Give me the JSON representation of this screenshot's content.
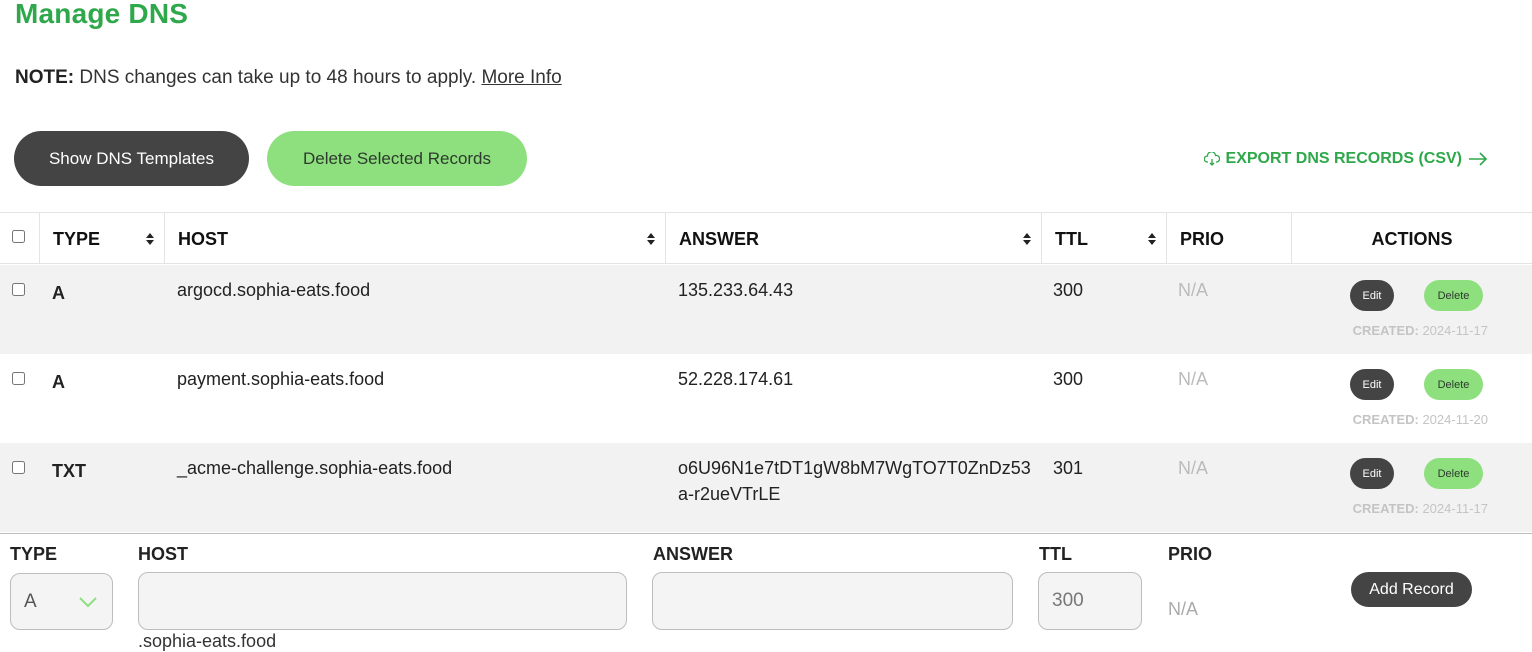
{
  "page": {
    "title": "Manage DNS",
    "note_label": "NOTE:",
    "note_text": " DNS changes can take up to 48 hours to apply. ",
    "note_link": "More Info"
  },
  "toolbar": {
    "show_templates_label": "Show DNS Templates",
    "delete_selected_label": "Delete Selected Records",
    "export_label": "EXPORT DNS RECORDS (CSV)",
    "export_icons": [
      "cloud-download-icon",
      "arrow-right-icon"
    ]
  },
  "colors": {
    "brand_green": "#2ea84a",
    "light_green": "#8ee07f",
    "dark_button": "#444444",
    "row_alt": "#f2f2f2"
  },
  "table": {
    "columns": [
      "TYPE",
      "HOST",
      "ANSWER",
      "TTL",
      "PRIO",
      "ACTIONS"
    ],
    "sortable": [
      "TYPE",
      "HOST",
      "ANSWER",
      "TTL"
    ],
    "edit_label": "Edit",
    "delete_label": "Delete",
    "created_label": "CREATED:",
    "rows": [
      {
        "type": "A",
        "host": "argocd.sophia-eats.food",
        "answer": "135.233.64.43",
        "ttl": "300",
        "prio": "N/A",
        "created": " 2024-11-17"
      },
      {
        "type": "A",
        "host": "payment.sophia-eats.food",
        "answer": "52.228.174.61",
        "ttl": "300",
        "prio": "N/A",
        "created": " 2024-11-20"
      },
      {
        "type": "TXT",
        "host": "_acme-challenge.sophia-eats.food",
        "answer": "o6U96N1e7tDT1gW8bM7WgTO7T0ZnDz53a-r2ueVTrLE",
        "ttl": "301",
        "prio": "N/A",
        "created": " 2024-11-17"
      }
    ]
  },
  "add_form": {
    "type_label": "TYPE",
    "host_label": "HOST",
    "answer_label": "ANSWER",
    "ttl_label": "TTL",
    "prio_label": "PRIO",
    "type_value": "A",
    "host_value": "",
    "answer_value": "",
    "ttl_value": "300",
    "prio_value": "N/A",
    "host_suffix": ".sophia-eats.food",
    "add_button_label": "Add Record"
  }
}
